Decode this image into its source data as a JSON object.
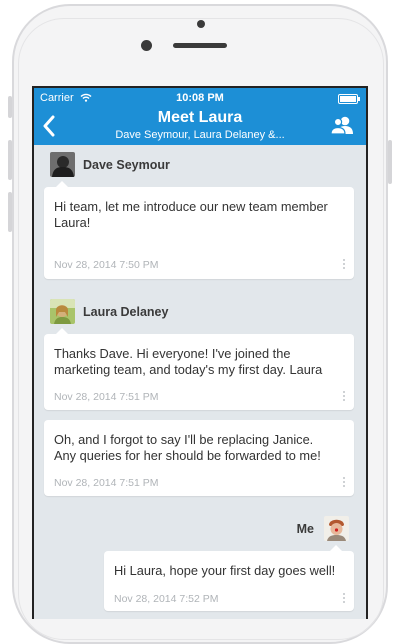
{
  "status_bar": {
    "carrier": "Carrier",
    "time": "10:08 PM"
  },
  "nav": {
    "title": "Meet Laura",
    "subtitle": "Dave Seymour, Laura Delaney &..."
  },
  "messages": [
    {
      "sender": "Dave Seymour",
      "text_lines": [
        "Hi team, let me introduce our new team member",
        "Laura!"
      ],
      "timestamp": "Nov 28, 2014 7:50 PM"
    },
    {
      "sender": "Laura Delaney",
      "text_lines": [
        "Thanks Dave. Hi everyone! I've joined the",
        "marketing team, and today's my first day. Laura"
      ],
      "timestamp": "Nov 28, 2014 7:51 PM"
    },
    {
      "sender": "",
      "text_lines": [
        "Oh, and I forgot to say I'll be replacing Janice.",
        "Any queries for her should be forwarded to me!"
      ],
      "timestamp": "Nov 28, 2014 7:51 PM"
    },
    {
      "sender": "Me",
      "text_lines": [
        "Hi Laura, hope your first day goes well!"
      ],
      "timestamp": "Nov 28, 2014 7:52 PM"
    }
  ],
  "colors": {
    "nav": "#1d8fd6",
    "background": "#e2e7eb"
  },
  "icons": {
    "back": "chevron-left-icon",
    "people": "people-icon",
    "more": "more-vertical-icon",
    "wifi": "wifi-icon",
    "battery": "battery-icon"
  }
}
